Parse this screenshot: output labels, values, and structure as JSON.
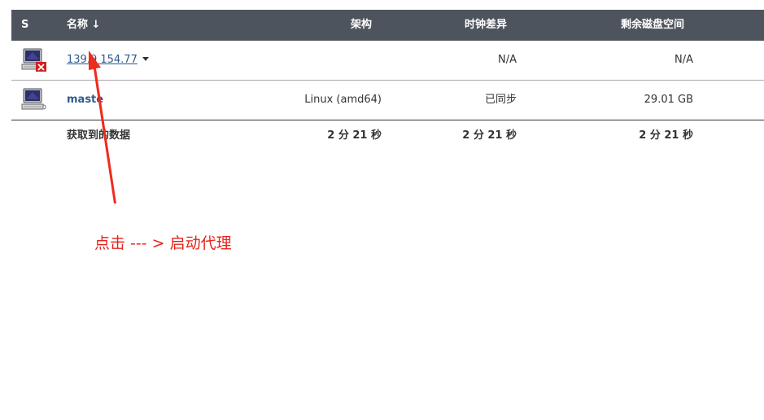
{
  "table": {
    "headers": {
      "status": "S",
      "name": "名称 ↓",
      "arch": "架构",
      "clock": "时钟差异",
      "disk": "剩余磁盘空间"
    },
    "rows": [
      {
        "name": "139.9 154.77",
        "arch": "",
        "clock": "N/A",
        "disk": "N/A",
        "status_icon": "computer-offline-icon"
      },
      {
        "name": "maste",
        "arch": "Linux (amd64)",
        "clock": "已同步",
        "disk": "29.01 GB",
        "status_icon": "computer-icon"
      }
    ],
    "footer": {
      "label": "获取到的数据",
      "arch": "2 分 21 秒",
      "clock": "2 分 21 秒",
      "disk": "2 分 21 秒"
    }
  },
  "annotation": {
    "text": "点击 --- > 启动代理",
    "color": "#e8231b"
  },
  "colors": {
    "header_bg": "#4d545d",
    "link": "#2f5a8c"
  }
}
